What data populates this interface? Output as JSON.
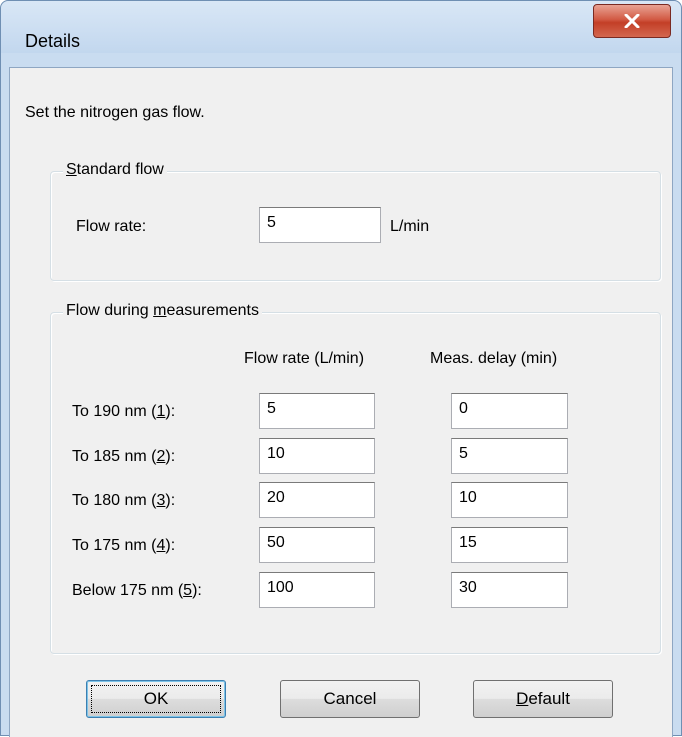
{
  "window": {
    "title": "Details"
  },
  "instruction": "Set the nitrogen gas flow.",
  "standard_flow": {
    "legend_access_key": "S",
    "legend_rest": "tandard flow",
    "flow_rate_label": "Flow rate:",
    "flow_rate_value": "5",
    "unit": "L/min"
  },
  "measurements": {
    "legend_prefix": "Flow during ",
    "legend_access_key": "m",
    "legend_rest": "easurements",
    "col_flow_rate": "Flow rate (L/min)",
    "col_delay": "Meas. delay (min)",
    "rows": [
      {
        "label_prefix": "To 190 nm (",
        "key": "1",
        "label_suffix": "):",
        "flow": "5",
        "delay": "0"
      },
      {
        "label_prefix": "To 185 nm (",
        "key": "2",
        "label_suffix": "):",
        "flow": "10",
        "delay": "5"
      },
      {
        "label_prefix": "To 180 nm (",
        "key": "3",
        "label_suffix": "):",
        "flow": "20",
        "delay": "10"
      },
      {
        "label_prefix": "To 175 nm (",
        "key": "4",
        "label_suffix": "):",
        "flow": "50",
        "delay": "15"
      },
      {
        "label_prefix": "Below 175 nm (",
        "key": "5",
        "label_suffix": "):",
        "flow": "100",
        "delay": "30"
      }
    ]
  },
  "buttons": {
    "ok": "OK",
    "cancel": "Cancel",
    "default_access_key": "D",
    "default_rest": "efault"
  }
}
